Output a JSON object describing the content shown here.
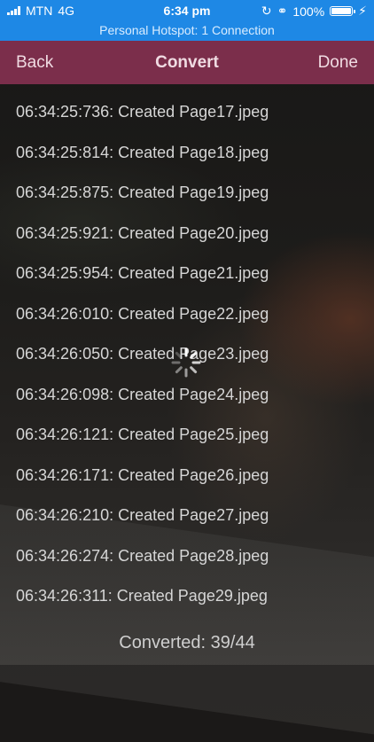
{
  "status_bar": {
    "carrier": "MTN",
    "network": "4G",
    "time": "6:34 pm",
    "battery": "100%"
  },
  "hotspot_banner": "Personal Hotspot: 1 Connection",
  "navbar": {
    "back_label": "Back",
    "title": "Convert",
    "done_label": "Done"
  },
  "log_lines": [
    "06:34:25:736: Created Page17.jpeg",
    "06:34:25:814: Created Page18.jpeg",
    "06:34:25:875: Created Page19.jpeg",
    "06:34:25:921: Created Page20.jpeg",
    "06:34:25:954: Created Page21.jpeg",
    "06:34:26:010: Created Page22.jpeg",
    "06:34:26:050: Created Page23.jpeg",
    "06:34:26:098: Created Page24.jpeg",
    "06:34:26:121: Created Page25.jpeg",
    "06:34:26:171: Created Page26.jpeg",
    "06:34:26:210: Created Page27.jpeg",
    "06:34:26:274: Created Page28.jpeg",
    "06:34:26:311: Created Page29.jpeg"
  ],
  "footer": {
    "progress_text": "Converted: 39/44"
  },
  "colors": {
    "status_bar": "#1e88e5",
    "navbar": "#7b2e4b"
  }
}
